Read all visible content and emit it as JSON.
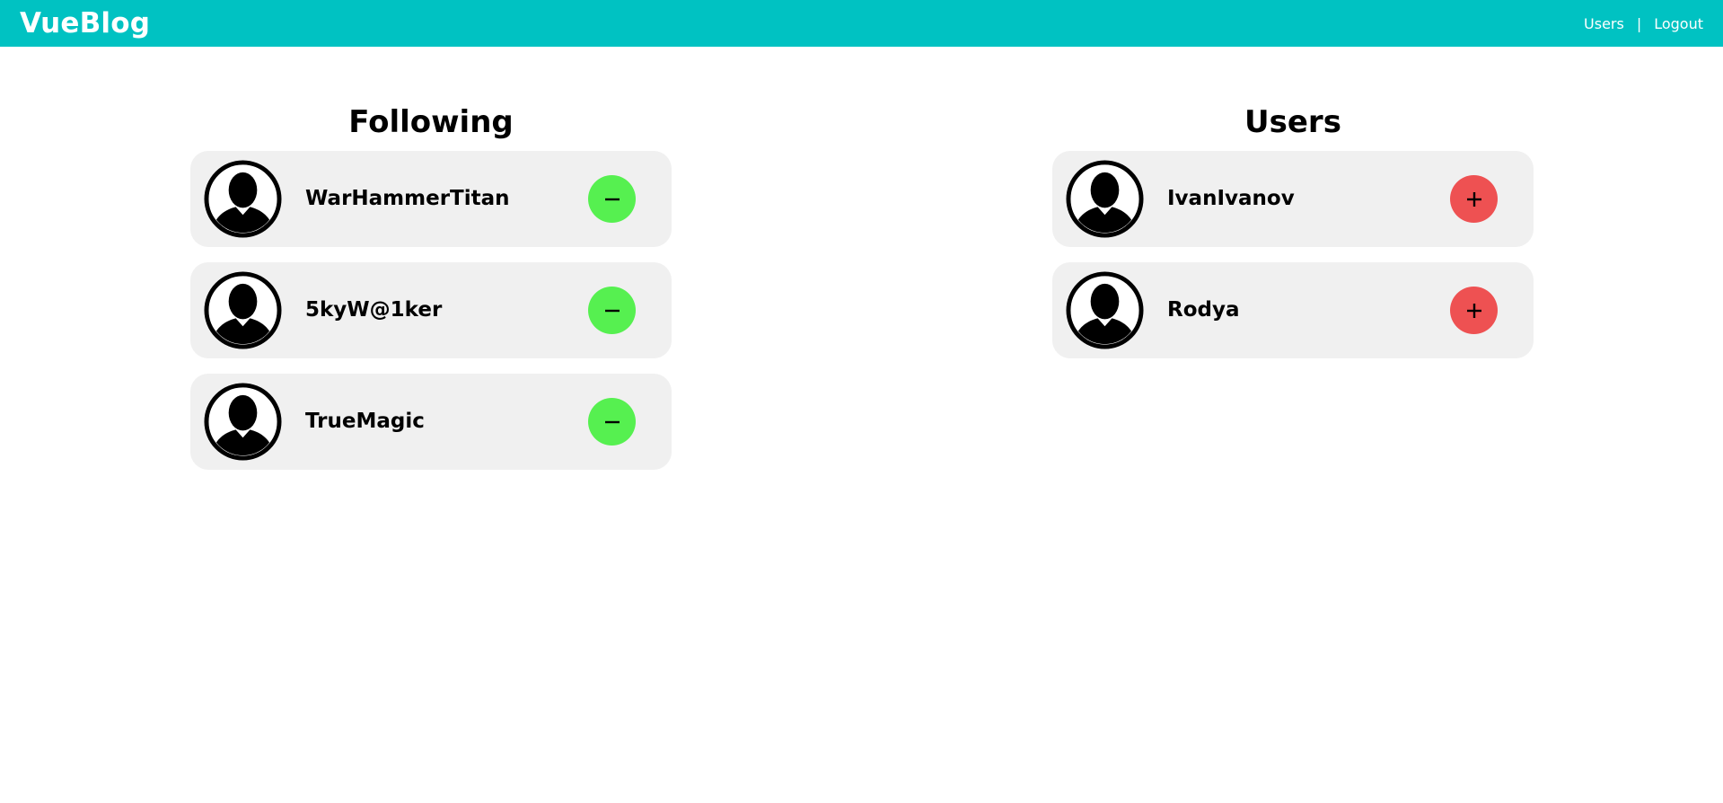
{
  "app": {
    "brand": "VueBlog"
  },
  "nav": {
    "users_label": "Users",
    "separator": "|",
    "logout_label": "Logout"
  },
  "colors": {
    "navbar": "#00c2c2",
    "unfollow_button": "#56f050",
    "follow_button": "#ee5152",
    "card": "#f0f0f0"
  },
  "following": {
    "title": "Following",
    "action_icon": "minus-icon",
    "items": [
      {
        "username": "WarHammerTitan",
        "avatar_icon": "user-avatar-icon"
      },
      {
        "username": "5kyW@1ker",
        "avatar_icon": "user-avatar-icon"
      },
      {
        "username": "TrueMagic",
        "avatar_icon": "user-avatar-icon"
      }
    ]
  },
  "users": {
    "title": "Users",
    "action_icon": "plus-icon",
    "items": [
      {
        "username": "IvanIvanov",
        "avatar_icon": "user-avatar-icon"
      },
      {
        "username": "Rodya",
        "avatar_icon": "user-avatar-icon"
      }
    ]
  }
}
